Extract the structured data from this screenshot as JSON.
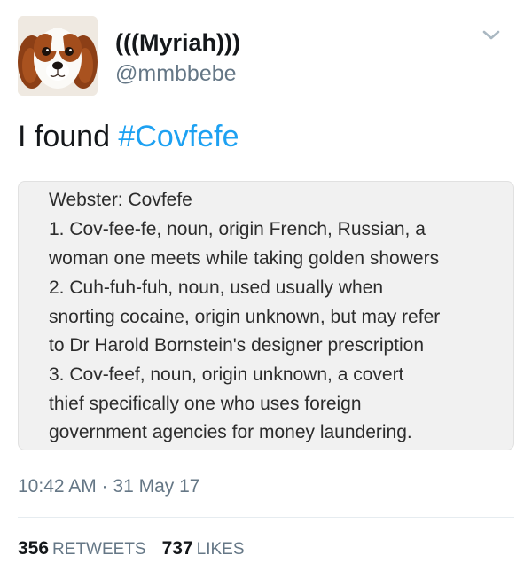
{
  "user": {
    "display_name": "(((Myriah)))",
    "handle": "@mmbbebe",
    "avatar": "cavalier-king-charles-spaniel-avatar"
  },
  "tweet": {
    "text_prefix": "I found ",
    "hashtag": "#Covfefe",
    "image_text_lines": [
      "Webster: Covfefe",
      "1. Cov-fee-fe, noun, origin French, Russian, a",
      "woman one meets while taking golden showers",
      "2. Cuh-fuh-fuh, noun, used usually when",
      "snorting cocaine, origin unknown, but may refer",
      "to Dr Harold Bornstein's designer prescription",
      "3. Cov-feef, noun, origin unknown, a covert",
      "thief specifically one who uses foreign",
      "government agencies for money laundering."
    ],
    "timestamp": "10:42 AM · 31 May 17"
  },
  "stats": {
    "retweets_count": "356",
    "retweets_label": "RETWEETS",
    "likes_count": "737",
    "likes_label": "LIKES"
  },
  "colors": {
    "link": "#1da1f2",
    "secondary_text": "#657786",
    "primary_text": "#14171a"
  },
  "icons": {
    "menu": "chevron-down-icon"
  }
}
